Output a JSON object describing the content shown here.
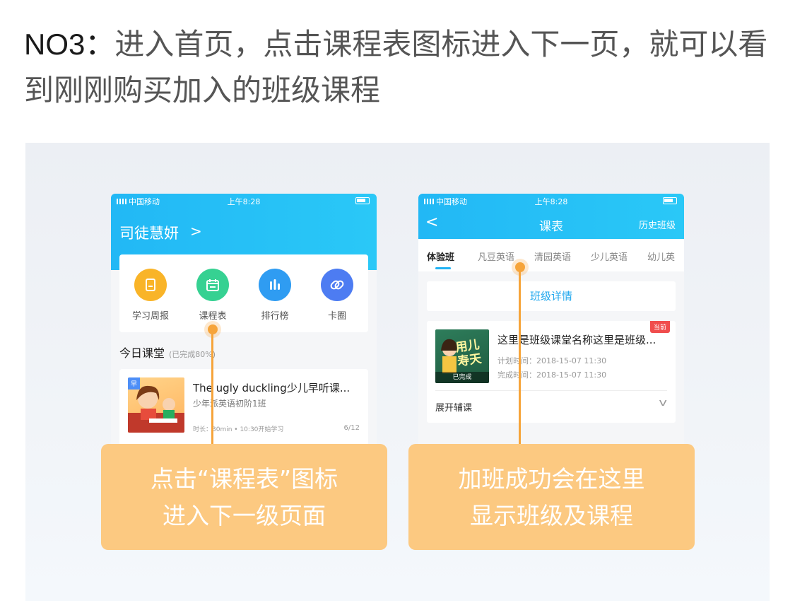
{
  "heading": {
    "prefix": "NO3：",
    "text": "进入首页，点击课程表图标进入下一页，就可以看到刚刚购买加入的班级课程"
  },
  "statusbar": {
    "carrier": "中国移动",
    "time": "上午8:28"
  },
  "left_phone": {
    "user_name": "司徒慧妍",
    "chevron": ">",
    "grid_items": [
      {
        "label": "学习周报",
        "icon": "report-icon",
        "color": "#f9b428"
      },
      {
        "label": "课程表",
        "icon": "calendar-icon",
        "color": "#36d192"
      },
      {
        "label": "排行榜",
        "icon": "ranking-icon",
        "color": "#2f9cf2"
      },
      {
        "label": "卡圈",
        "icon": "link-icon",
        "color": "#4d7cf2"
      }
    ],
    "section_title": "今日课堂",
    "section_progress": "(已完成80%)",
    "card": {
      "tag": "早",
      "title": "The ugly duckling少儿早听课...",
      "subtitle": "少年派英语初阶1班",
      "meta": "时长：30min • 10:30开始学习",
      "progress": "6/12"
    }
  },
  "right_phone": {
    "back": "<",
    "title": "课表",
    "history": "历史班级",
    "tabs": [
      "体验班",
      "凡豆英语",
      "清园英语",
      "少儿英语",
      "幼儿英"
    ],
    "active_tab": 0,
    "detail_button": "班级详情",
    "card": {
      "badge": "当前",
      "thumb_text": "用儿\n寿天",
      "done_label": "已完成",
      "title": "这里是班级课堂名称这里是班级...",
      "plan_time": "计划时间：2018-15-07  11:30",
      "finish_time": "完成时间：2018-15-07  11:30",
      "expand": "展开辅课",
      "expand_chevron": "v"
    }
  },
  "callouts": {
    "left": {
      "line1": "点击“课程表”图标",
      "line2": "进入下一级页面"
    },
    "right": {
      "line1": "加班成功会在这里",
      "line2": "显示班级及课程"
    }
  },
  "colors": {
    "accent": "#22b8f5",
    "callout": "#fcc981",
    "marker": "#f6a43a"
  }
}
